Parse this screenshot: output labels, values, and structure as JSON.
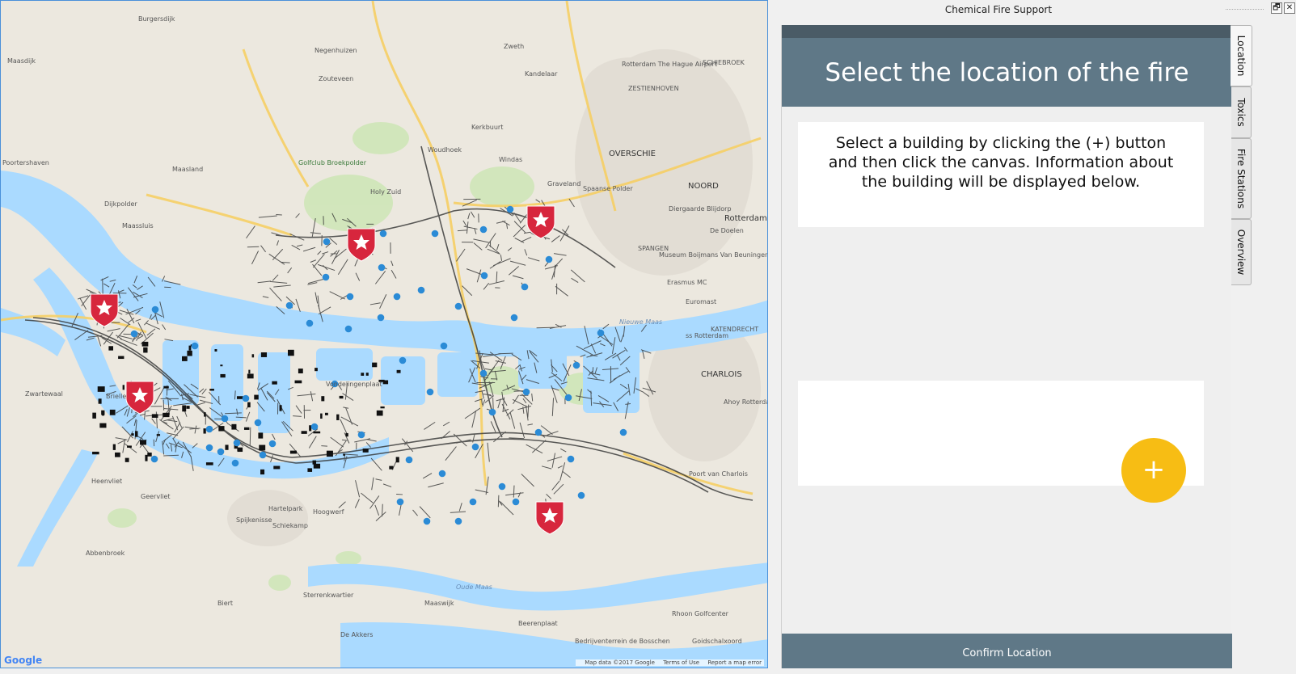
{
  "dock": {
    "title": "Chemical Fire Support",
    "float_button": "🗗",
    "close_button": "✕"
  },
  "panel": {
    "header_title": "Select the location of the fire",
    "instructions": "Select a building by clicking the (+) button and then click the canvas. Information about the building will be displayed below.",
    "add_button": "+",
    "confirm_label": "Confirm Location"
  },
  "tabs": [
    {
      "label": "Location",
      "active": true
    },
    {
      "label": "Toxics",
      "active": false
    },
    {
      "label": "Fire Stations",
      "active": false
    },
    {
      "label": "Overview",
      "active": false
    }
  ],
  "map": {
    "provider": "Google",
    "attribution": [
      "Map data ©2017 Google",
      "Terms of Use",
      "Report a map error"
    ],
    "labels": [
      "Burgersdijk",
      "Maasdijk",
      "Negenhuizen",
      "Zouteveen",
      "Zweth",
      "Kandelaar",
      "Rotterdam The Hague Airport",
      "ZESTIENHOVEN",
      "SCHIEBROEK",
      "Kerkbuurt",
      "Woudhoek",
      "Windas",
      "OVERSCHIE",
      "Poortershaven",
      "Maasland",
      "Golfclub Broekpolder",
      "Holy Zuid",
      "Graveland",
      "Spaanse Polder",
      "NOORD",
      "Diergaarde Blijdorp",
      "Rotterdam",
      "Dijkpolder",
      "Maassluis",
      "De Doelen",
      "SPANGEN",
      "Museum Boijmans Van Beuningen",
      "Erasmus MC",
      "Euromast",
      "ss Rotterdam",
      "KATENDRECHT",
      "CHARLOIS",
      "Ahoy Rotterdam",
      "Zwartewaal",
      "Heenvliet",
      "Geervliet",
      "Spijkenisse",
      "Hartelpark",
      "Hoogwerf",
      "Schiekamp",
      "Abbenbroek",
      "Biert",
      "Sterrenkwartier",
      "Maaswijk",
      "Beerenplaat",
      "De Akkers",
      "Bedrijventerrein de Bosschen",
      "Rhoon Golfcenter",
      "Poort van Charlois",
      "Goidschalxoord",
      "Vondelingenplaat",
      "Nieuwe Maas",
      "Oude Maas",
      "Brielle"
    ],
    "fire_station_count": 5,
    "water_color": "#aadaff",
    "land_color": "#e9e5dc",
    "station_color": "#d7263d",
    "building_marker_color": "#2b8bd6"
  },
  "colors": {
    "header_bg": "#5f7887",
    "topbar_bg": "#4a5b66",
    "accent": "#f7bd14"
  }
}
